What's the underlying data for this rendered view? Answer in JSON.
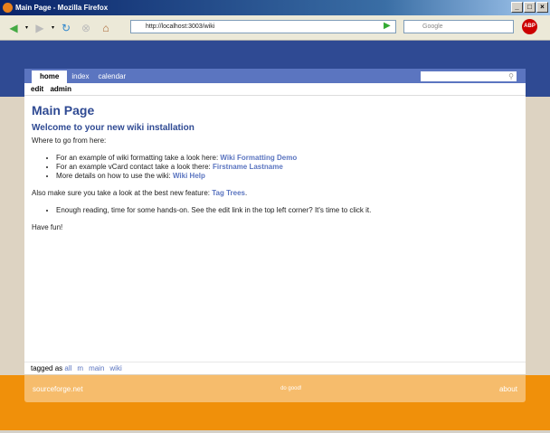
{
  "window": {
    "title": "Main Page - Mozilla Firefox"
  },
  "browser": {
    "url": "http://localhost:3003/wiki",
    "search_placeholder": "Google"
  },
  "tabs": [
    {
      "label": "home"
    },
    {
      "label": "index"
    },
    {
      "label": "calendar"
    }
  ],
  "subnav": [
    {
      "label": "edit"
    },
    {
      "label": "admin"
    }
  ],
  "content": {
    "title": "Main Page",
    "subtitle": "Welcome to your new wiki installation",
    "intro": "Where to go from here:",
    "items": [
      {
        "text": "For an example of wiki formatting take a look here: ",
        "link": "Wiki Formatting Demo"
      },
      {
        "text": "For an example vCard contact take a look there: ",
        "link": "Firstname Lastname"
      },
      {
        "text": "More details on how to use the wiki: ",
        "link": "Wiki Help"
      }
    ],
    "feature_text": "Also make sure you take a look at the best new feature: ",
    "feature_link": "Tag Trees",
    "feature_end": ".",
    "item2": "Enough reading, time for some hands-on. See the edit link in the top left corner? It's time to click it.",
    "outro": "Have fun!"
  },
  "tagged": {
    "label": "tagged as",
    "tags": [
      "all",
      "m",
      "main",
      "wiki"
    ]
  },
  "footer": {
    "left": "sourceforge.net",
    "center": "do good!",
    "right": "about"
  }
}
